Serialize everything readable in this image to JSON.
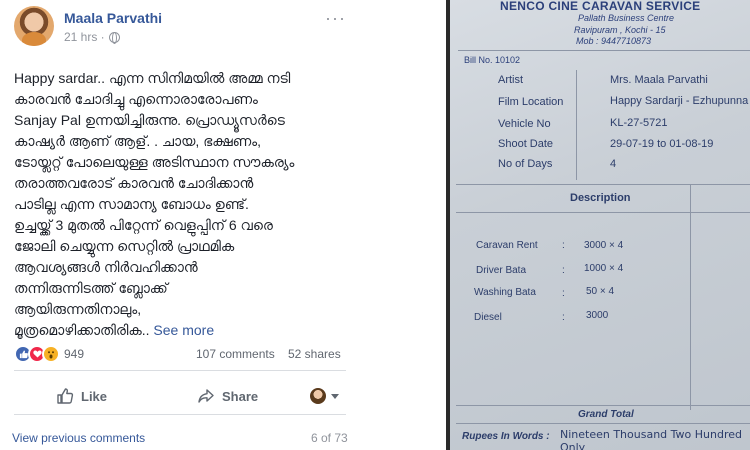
{
  "post": {
    "author": "Maala Parvathi",
    "timestamp": "21 hrs ·",
    "menu": "···",
    "text": "Happy sardar.. എന്ന സിനിമയിൽ അമ്മ നടി\nകാരവൻ ചോദിച്ചു എന്നൊരാരോപണം\nSanjay Pal ഉന്നയിച്ചിരുന്നു. പ്രൊഡ്യൂസർടെ\nകാഷ്യർ ആണ് ആള്. . ചായ, ഭക്ഷണം,\nടോയ്ലറ്റ് പോലെയുള്ള അടിസ്ഥാന സൗകര്യം\nതരാത്തവരോട് കാരവൻ ചോദിക്കാൻ\nപാടില്ല എന്ന സാമാന്യ ബോധം ഉണ്ട്.\nഉച്ചയ്ക്ക് 3 മുതൽ പിറ്റേന്ന് വെളുപ്പിന് 6 വരെ\nജോലി ചെയ്യുന്ന സെറ്റിൽ പ്രാഥമിക\nആവശ്യങ്ങൾ നിർവഹിക്കാൻ\nതന്നിരുന്നിടത്ത് ബ്ലോക്ക്\nആയിരുന്നതിനാലും,\nമൂത്രമൊഴിക്കാതിരിക..",
    "see_more": "See more",
    "reaction_count": "949",
    "comments": "107 comments",
    "shares": "52 shares",
    "like_label": "Like",
    "share_label": "Share",
    "view_previous": "View previous comments",
    "page_count": "6 of 73",
    "colors": {
      "link": "#365899",
      "like": "#4267b2",
      "love": "#f0284a",
      "wow": "#f7b125"
    }
  },
  "bill": {
    "company": "NENCO CINE CARAVAN SERVICE",
    "address_1": "Pallath Business Centre",
    "address_2": "Ravipuram , Kochi - 15",
    "phone": "Mob : 9447710873",
    "bill_no": "Bill No. 10102",
    "fields": [
      {
        "label": "Artist",
        "value": "Mrs. Maala Parvathi"
      },
      {
        "label": "Film Location",
        "value": "Happy Sardarji - Ezhupunna"
      },
      {
        "label": "Vehicle No",
        "value": "KL-27-5721"
      },
      {
        "label": "Shoot Date",
        "value": "29-07-19  to 01-08-19"
      },
      {
        "label": "No of Days",
        "value": "4"
      }
    ],
    "description_header": "Description",
    "items": [
      {
        "label": "Caravan Rent",
        "colon": ":",
        "value": "3000 × 4"
      },
      {
        "label": "Driver Bata",
        "colon": ":",
        "value": "1000 × 4"
      },
      {
        "label": "Washing Bata",
        "colon": ":",
        "value": "50 × 4"
      },
      {
        "label": "Diesel",
        "colon": ":",
        "value": "3000"
      }
    ],
    "grand_total": "Grand Total",
    "in_words_label": "Rupees In Words :",
    "in_words_value": "Nineteen Thousand Two Hundred Only"
  }
}
